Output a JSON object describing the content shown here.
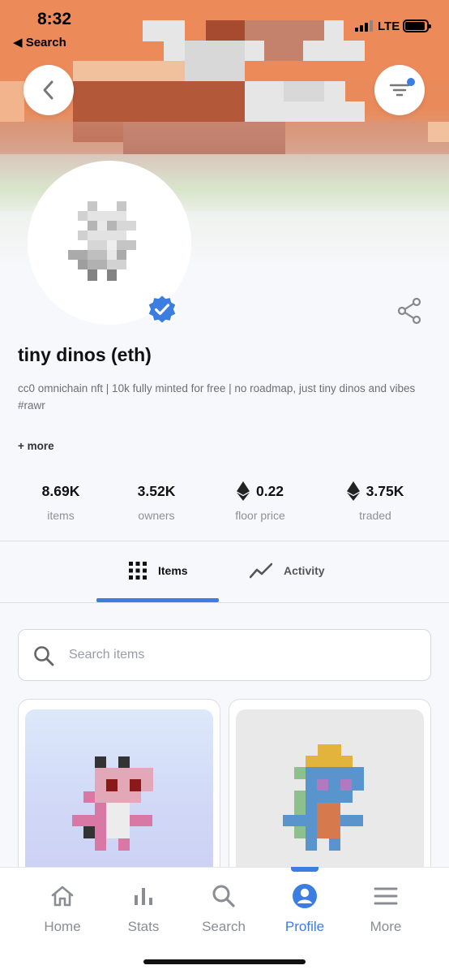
{
  "status_bar": {
    "time": "8:32",
    "back_label": "◀ Search",
    "network": "LTE"
  },
  "header": {
    "back_icon": "chevron-left-icon",
    "filter_icon": "filter-icon"
  },
  "collection": {
    "name": "tiny dinos (eth)",
    "description": "cc0 omnichain nft | 10k fully minted for free | no roadmap, just tiny dinos and vibes #rawr",
    "more_label": "+ more",
    "verified": true
  },
  "stats": [
    {
      "value": "8.69K",
      "label": "items",
      "eth": false
    },
    {
      "value": "3.52K",
      "label": "owners",
      "eth": false
    },
    {
      "value": "0.22",
      "label": "floor price",
      "eth": true
    },
    {
      "value": "3.75K",
      "label": "traded",
      "eth": true
    }
  ],
  "tabs": [
    {
      "label": "Items",
      "icon": "grid-icon",
      "active": true
    },
    {
      "label": "Activity",
      "icon": "chart-line-icon",
      "active": false
    }
  ],
  "search": {
    "placeholder": "Search items",
    "value": ""
  },
  "bottom_nav": [
    {
      "label": "Home",
      "icon": "home-icon",
      "active": false
    },
    {
      "label": "Stats",
      "icon": "bar-chart-icon",
      "active": false
    },
    {
      "label": "Search",
      "icon": "search-icon",
      "active": false
    },
    {
      "label": "Profile",
      "icon": "profile-icon",
      "active": true
    },
    {
      "label": "More",
      "icon": "menu-icon",
      "active": false
    }
  ],
  "colors": {
    "accent": "#3b7de0",
    "banner": "#e98a5a"
  }
}
